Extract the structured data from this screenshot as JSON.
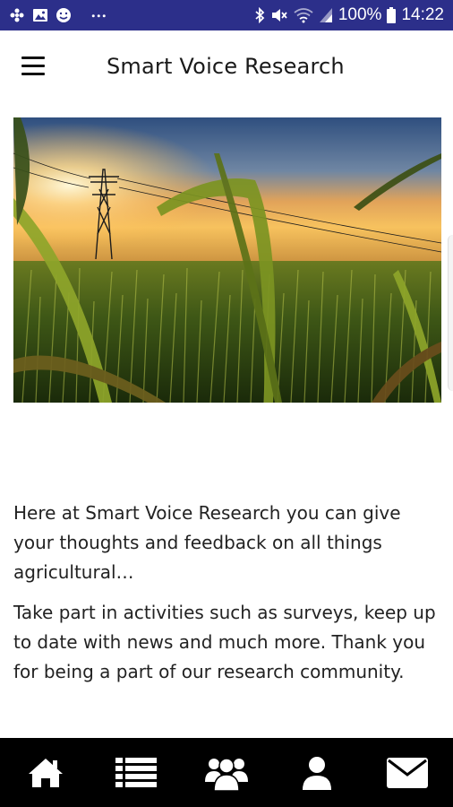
{
  "status_bar": {
    "left_icons": [
      "pinwheel-icon",
      "image-icon",
      "smiley-icon",
      "more-dots-icon"
    ],
    "right_icons": [
      "bluetooth-icon",
      "mute-icon",
      "wifi-icon",
      "signal-icon",
      "battery-icon"
    ],
    "battery": "100%",
    "time": "14:22"
  },
  "header": {
    "title": "Smart Voice Research",
    "menu_icon": "hamburger-menu-icon"
  },
  "hero": {
    "icon": "field-sunset-image"
  },
  "content": {
    "paragraphs": [
      "Here at Smart Voice Research you can give your thoughts and feedback on all things agricultural…",
      "Take part in activities such as surveys, keep up to date with news and much more. Thank you for being a part of our research community."
    ]
  },
  "bottom_nav": {
    "items": [
      {
        "name": "home",
        "icon": "home-icon"
      },
      {
        "name": "list",
        "icon": "list-icon"
      },
      {
        "name": "community",
        "icon": "group-icon"
      },
      {
        "name": "profile",
        "icon": "user-icon"
      },
      {
        "name": "messages",
        "icon": "envelope-icon"
      }
    ]
  },
  "colors": {
    "status_bar": "#2c2f8a",
    "bottom_nav": "#000000",
    "text": "#222222"
  }
}
